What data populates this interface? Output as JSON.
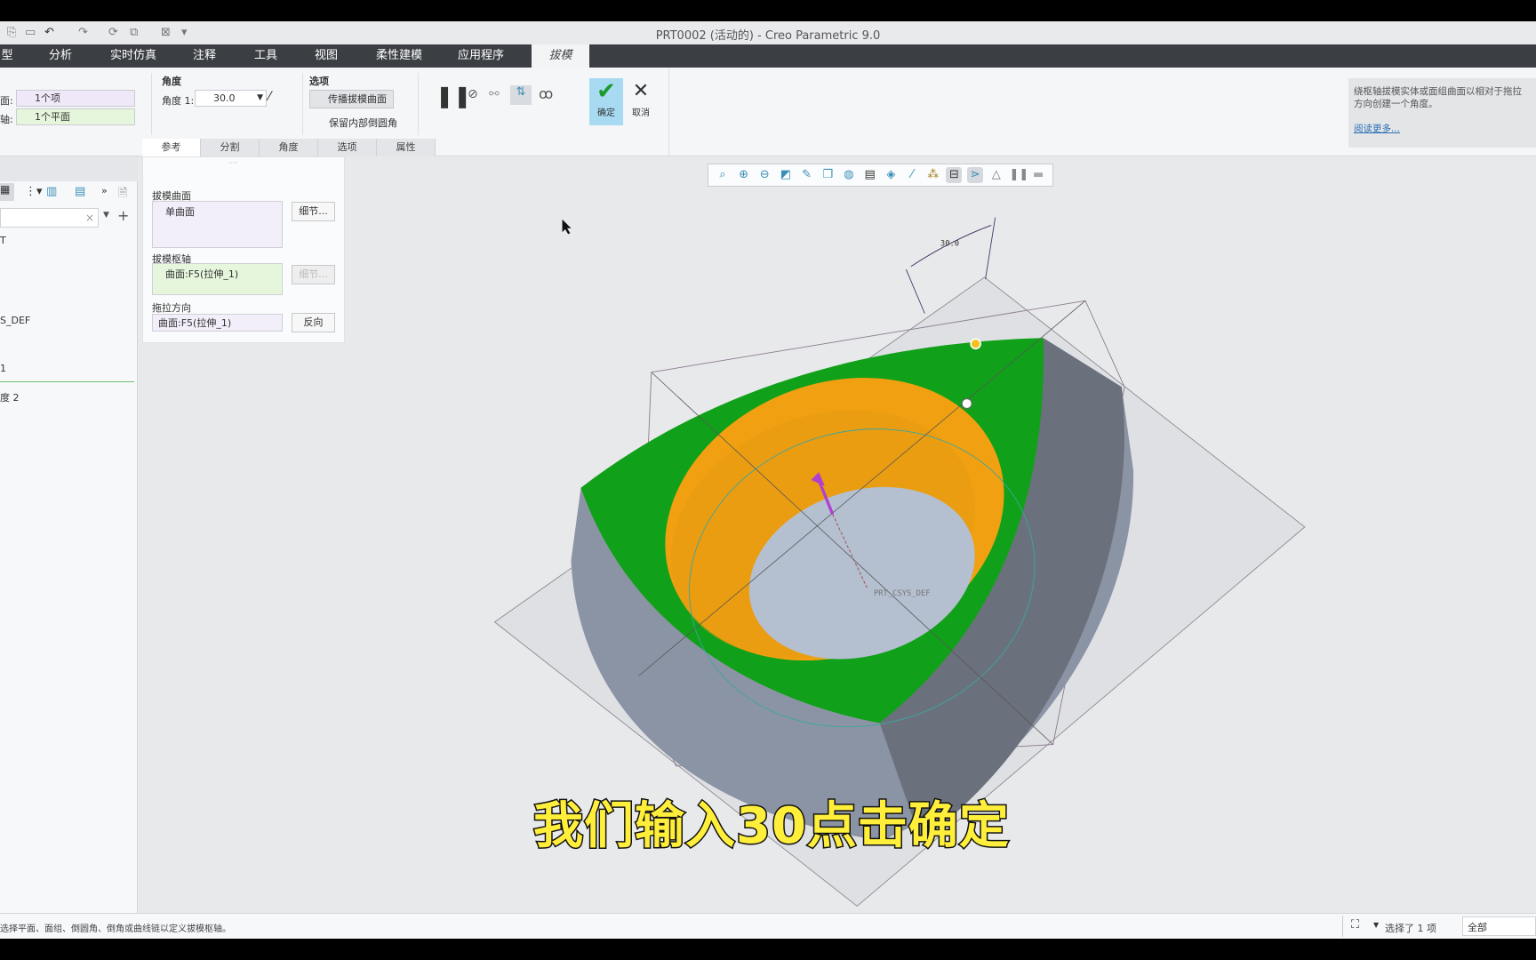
{
  "window": {
    "title": "PRT0002 (活动的) - Creo Parametric 9.0"
  },
  "ribbon_tabs": [
    {
      "label": "型"
    },
    {
      "label": "分析"
    },
    {
      "label": "实时仿真"
    },
    {
      "label": "注释"
    },
    {
      "label": "工具"
    },
    {
      "label": "视图"
    },
    {
      "label": "柔性建模"
    },
    {
      "label": "应用程序"
    },
    {
      "label": "拔模",
      "active": true
    }
  ],
  "ribbon": {
    "surface_label": "面:",
    "surface_value": "1个项",
    "axis_label": "轴:",
    "axis_value": "1个平面",
    "angle_group": "角度",
    "angle1_label": "角度 1:",
    "angle1_value": "30.0",
    "options_group": "选项",
    "propagate_label": "传播拔模曲面",
    "keep_rounds_label": "保留内部倒圆角",
    "ok_label": "确定",
    "cancel_label": "取消"
  },
  "subtabs": [
    {
      "label": "参考",
      "active": true
    },
    {
      "label": "分割"
    },
    {
      "label": "角度"
    },
    {
      "label": "选项"
    },
    {
      "label": "属性"
    }
  ],
  "help": {
    "text": "绕枢轴拔模实体或面组曲面以相对于拖拉方向创建一个角度。",
    "link": "阅读更多..."
  },
  "dashboard": {
    "draft_surfaces_label": "拔模曲面",
    "draft_surfaces_value": "单曲面",
    "details_label": "细节...",
    "pivot_label": "拔模枢轴",
    "pivot_value": "曲面:F5(拉伸_1)",
    "pivot_details_label": "细节...",
    "pull_dir_label": "拖拉方向",
    "pull_dir_value": "曲面:F5(拉伸_1)",
    "flip_label": "反向"
  },
  "tree": {
    "items": [
      {
        "label": "T"
      },
      {
        "label": "S_DEF"
      },
      {
        "label": "1"
      },
      {
        "label": "度 2"
      }
    ]
  },
  "graphics": {
    "dim_label": "30.0",
    "csys_label": "PRT_CSYS_DEF",
    "subtitle": "我们输入30点击确定",
    "colors": {
      "draft_face": "#11a01a",
      "inner_wall": "#f0a010",
      "body": "#8a93a3"
    }
  },
  "status": {
    "message": "选择平面、面组、倒圆角、倒角或曲线链以定义拔模枢轴。",
    "selection": "选择了 1 项",
    "filter": "全部"
  }
}
